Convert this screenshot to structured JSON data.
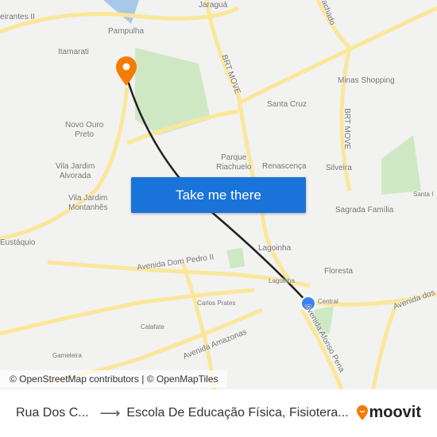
{
  "map": {
    "labels": {
      "bandeirantes": "eirantes II",
      "pampulha": "Pampulha",
      "jaragua": "Jaraguá",
      "itamarati": "Itamarati",
      "brt1": "BRT MOVE",
      "brt2": "BRT MOVE",
      "minas_shopping": "Minas Shopping",
      "santa_cruz": "Santa Cruz",
      "novo_ouro_preto": "Novo Ouro\nPreto",
      "parque_riachuelo": "Parque\nRiachuelo",
      "renascenca": "Renascença",
      "silveira": "Silveira",
      "vila_jardim_alvorada": "Vila Jardim\nAlvorada",
      "vila_jardim_montanhes": "Vila Jardim\nMontanhês",
      "sagrada_familia": "Sagrada Família",
      "santa": "Santa I",
      "eustaquio": "Eustáquio",
      "lagoinha": "Lagoinha",
      "floresta": "Floresta",
      "dom_pedro": "Avenida Dom Pedro II",
      "lagoinha_station": "Lagoinha",
      "central": "Central",
      "carlos_prates": "Carlos Prates",
      "av_dos": "Avenida dos",
      "calafate": "Calafate",
      "amazonas": "Avenida Amazonas",
      "afonso_pena": "Avenida Afonso Pena",
      "gameleira": "Gameleira",
      "riachado": "achado"
    },
    "colors": {
      "route": "#222222",
      "origin": "#3b82f6",
      "destination": "#f57c00",
      "button": "#1a73d9"
    }
  },
  "button": {
    "label": "Take me there"
  },
  "attribution": "© OpenStreetMap contributors | © OpenMapTiles",
  "footer": {
    "origin": "Rua Dos C...",
    "destination": "Escola De Educação Física, Fisiotera...",
    "brand": "moovit",
    "arrow_icon": "arrow-right-icon"
  }
}
